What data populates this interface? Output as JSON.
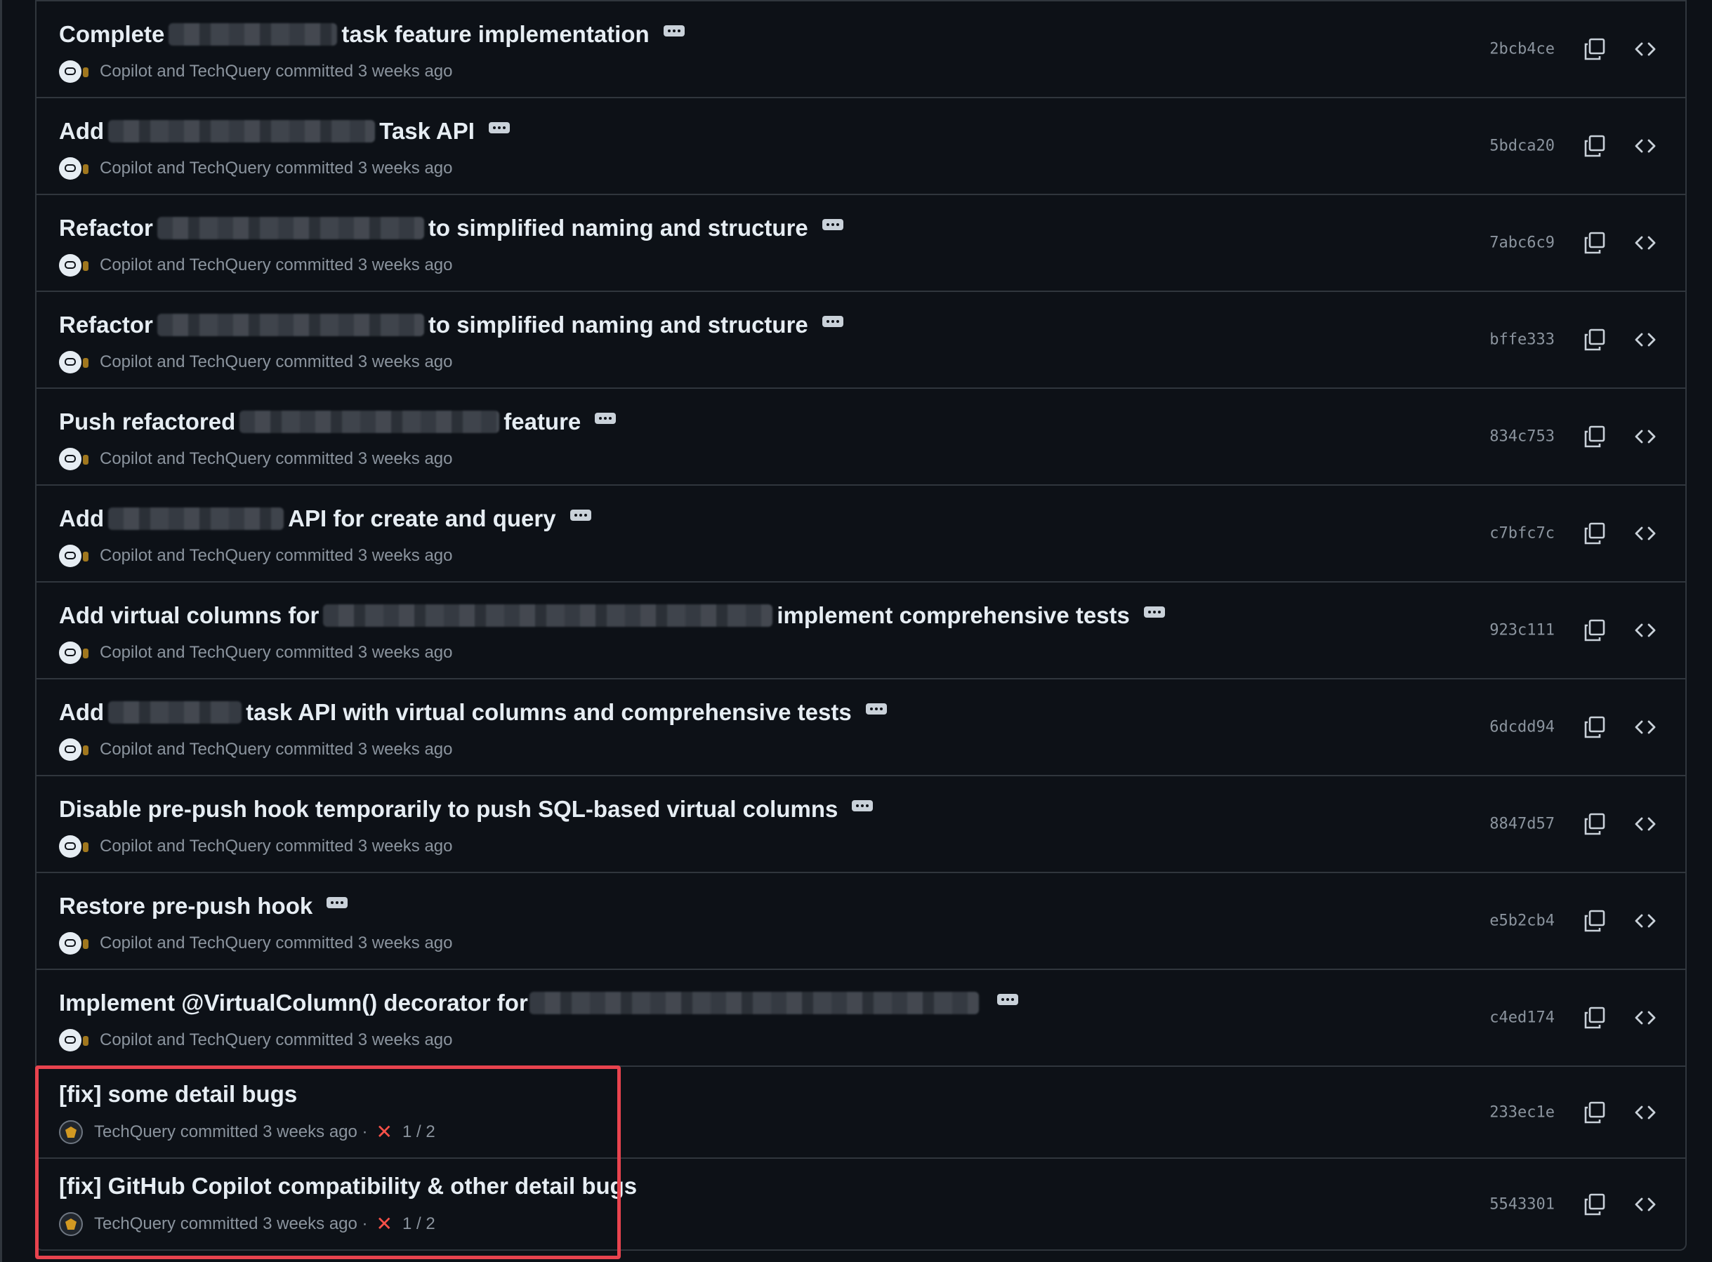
{
  "commits": [
    {
      "pre": "Complete",
      "post": "task feature implementation",
      "author": "Copilot and TechQuery",
      "verb": "committed",
      "time": "3 weeks ago",
      "sha": "2bcb4ce"
    },
    {
      "pre": "Add",
      "post": "Task API",
      "author": "Copilot and TechQuery",
      "verb": "committed",
      "time": "3 weeks ago",
      "sha": "5bdca20"
    },
    {
      "pre": "Refactor",
      "post": "to simplified naming and structure",
      "author": "Copilot and TechQuery",
      "verb": "committed",
      "time": "3 weeks ago",
      "sha": "7abc6c9"
    },
    {
      "pre": "Refactor",
      "post": "to simplified naming and structure",
      "author": "Copilot and TechQuery",
      "verb": "committed",
      "time": "3 weeks ago",
      "sha": "bffe333"
    },
    {
      "pre": "Push refactored",
      "post": "feature",
      "author": "Copilot and TechQuery",
      "verb": "committed",
      "time": "3 weeks ago",
      "sha": "834c753"
    },
    {
      "pre": "Add",
      "post": "API for create and query",
      "author": "Copilot and TechQuery",
      "verb": "committed",
      "time": "3 weeks ago",
      "sha": "c7bfc7c"
    },
    {
      "pre": "Add virtual columns for",
      "post": "implement comprehensive tests",
      "author": "Copilot and TechQuery",
      "verb": "committed",
      "time": "3 weeks ago",
      "sha": "923c111"
    },
    {
      "pre": "Add",
      "post": "task API with virtual columns and comprehensive tests",
      "author": "Copilot and TechQuery",
      "verb": "committed",
      "time": "3 weeks ago",
      "sha": "6dcdd94"
    },
    {
      "pre": "Disable pre-push hook temporarily to push SQL-based virtual columns",
      "post": "",
      "author": "Copilot and TechQuery",
      "verb": "committed",
      "time": "3 weeks ago",
      "sha": "8847d57"
    },
    {
      "pre": "Restore pre-push hook",
      "post": "",
      "author": "Copilot and TechQuery",
      "verb": "committed",
      "time": "3 weeks ago",
      "sha": "e5b2cb4"
    },
    {
      "pre": "Implement @VirtualColumn() decorator for",
      "post": "",
      "author": "Copilot and TechQuery",
      "verb": "committed",
      "time": "3 weeks ago",
      "sha": "c4ed174"
    },
    {
      "pre": "[fix] some detail bugs",
      "post": "",
      "author": "TechQuery",
      "verb": "committed",
      "time": "3 weeks ago",
      "sep": "·",
      "checks": "1 / 2",
      "sha": "233ec1e"
    },
    {
      "pre": "[fix] GitHub Copilot compatibility & other detail bugs",
      "post": "",
      "author": "TechQuery",
      "verb": "committed",
      "time": "3 weeks ago",
      "sep": "·",
      "checks": "1 / 2",
      "sha": "5543301"
    }
  ],
  "colors": {
    "background": "#0d1117",
    "border": "#30363d",
    "text": "#e6edf3",
    "muted": "#8b949e",
    "fail": "#f85149",
    "highlight": "#e8434e"
  },
  "icons": {
    "copy": "copy-icon",
    "browse": "code-icon",
    "more": "ellipsis-icon",
    "fail": "x-icon"
  }
}
